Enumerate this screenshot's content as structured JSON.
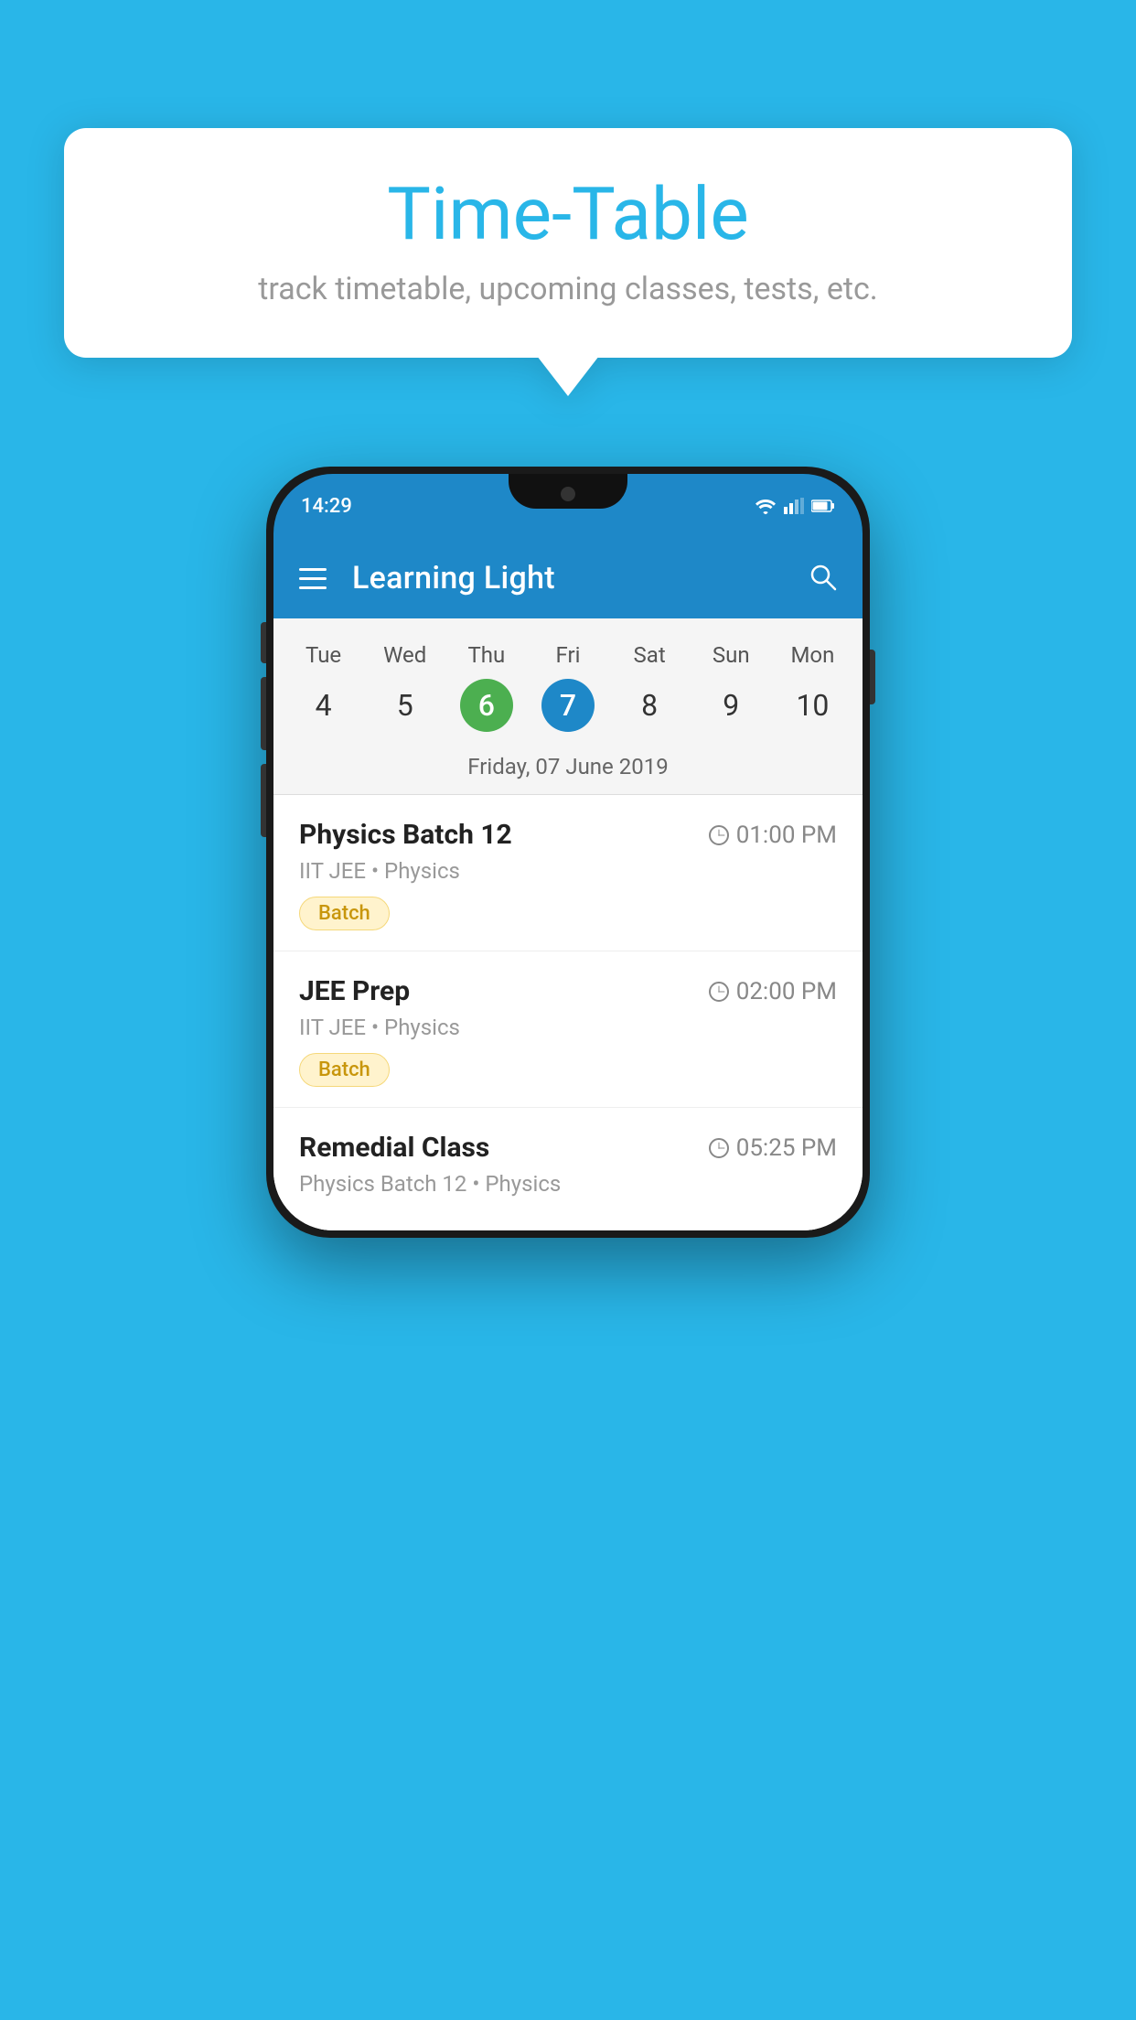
{
  "background_color": "#29B6E8",
  "bubble": {
    "title": "Time-Table",
    "subtitle": "track timetable, upcoming classes, tests, etc."
  },
  "phone": {
    "status_bar": {
      "time": "14:29"
    },
    "app_bar": {
      "title": "Learning Light"
    },
    "calendar": {
      "days_of_week": [
        "Tue",
        "Wed",
        "Thu",
        "Fri",
        "Sat",
        "Sun",
        "Mon"
      ],
      "day_numbers": [
        "4",
        "5",
        "6",
        "7",
        "8",
        "9",
        "10"
      ],
      "today_index": 2,
      "selected_index": 3,
      "selected_date_label": "Friday, 07 June 2019"
    },
    "schedule": [
      {
        "title": "Physics Batch 12",
        "time": "01:00 PM",
        "subtitle": "IIT JEE • Physics",
        "tag": "Batch"
      },
      {
        "title": "JEE Prep",
        "time": "02:00 PM",
        "subtitle": "IIT JEE • Physics",
        "tag": "Batch"
      },
      {
        "title": "Remedial Class",
        "time": "05:25 PM",
        "subtitle": "Physics Batch 12 • Physics",
        "tag": ""
      }
    ]
  }
}
